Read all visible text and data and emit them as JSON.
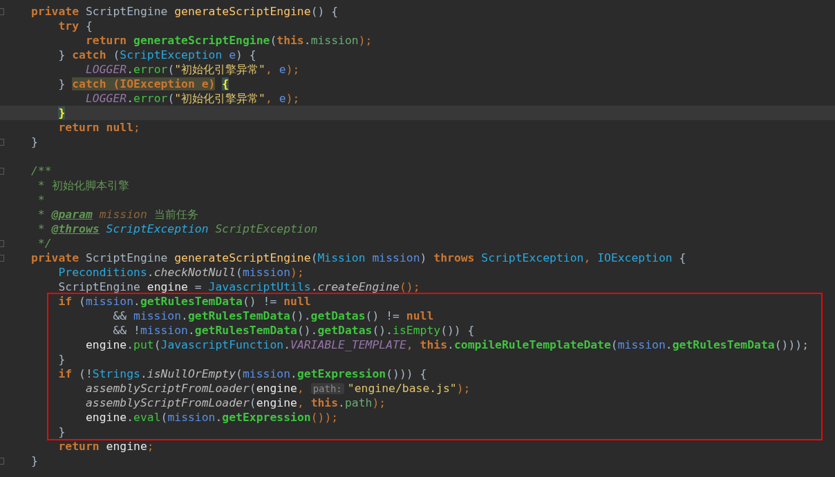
{
  "editor": {
    "lines": [
      {
        "kind": "code",
        "fold": true,
        "current": false,
        "tokens": [
          {
            "text": "private ",
            "kind": "kw"
          },
          {
            "text": "ScriptEngine ",
            "kind": "id"
          },
          {
            "text": "generateScriptEngine",
            "kind": "decl"
          },
          {
            "text": "() {",
            "kind": "id"
          }
        ],
        "children": [
          {
            "kind": "code",
            "fold": false,
            "current": false,
            "tokens": [
              {
                "text": "try ",
                "kind": "kw"
              },
              {
                "text": "{",
                "kind": "id"
              }
            ],
            "children": [
              {
                "kind": "code",
                "fold": false,
                "current": false,
                "tokens": [
                  {
                    "text": "return ",
                    "kind": "kw"
                  },
                  {
                    "text": "generateScriptEngine",
                    "kind": "call"
                  },
                  {
                    "text": "(",
                    "kind": "id"
                  },
                  {
                    "text": "this",
                    "kind": "kw"
                  },
                  {
                    "text": ".",
                    "kind": "id"
                  },
                  {
                    "text": "mission",
                    "kind": "field"
                  },
                  {
                    "text": ");",
                    "kind": "punct"
                  }
                ]
              }
            ]
          },
          {
            "kind": "code",
            "fold": false,
            "current": false,
            "tokens": [
              {
                "text": "} ",
                "kind": "id"
              },
              {
                "text": "catch ",
                "kind": "kw"
              },
              {
                "text": "(",
                "kind": "id"
              },
              {
                "text": "ScriptException ",
                "kind": "cls"
              },
              {
                "text": "e",
                "kind": "param"
              },
              {
                "text": ") {",
                "kind": "id"
              }
            ],
            "children": [
              {
                "kind": "code",
                "fold": false,
                "current": false,
                "tokens": [
                  {
                    "text": "LOGGER",
                    "kind": "const"
                  },
                  {
                    "text": ".",
                    "kind": "id"
                  },
                  {
                    "text": "error",
                    "kind": "call2"
                  },
                  {
                    "text": "(",
                    "kind": "id"
                  },
                  {
                    "text": "\"初始化引擎异常\"",
                    "kind": "str"
                  },
                  {
                    "text": ", ",
                    "kind": "punct"
                  },
                  {
                    "text": "e",
                    "kind": "param"
                  },
                  {
                    "text": ");",
                    "kind": "punct"
                  }
                ]
              }
            ]
          },
          {
            "kind": "code",
            "fold": false,
            "current": false,
            "tokens": [
              {
                "text": "} ",
                "kind": "id"
              },
              {
                "text": "catch (IOException e)",
                "kind": "hl"
              },
              {
                "text": "{",
                "kind": "brace"
              }
            ],
            "children": [
              {
                "kind": "code",
                "fold": false,
                "current": false,
                "tokens": [
                  {
                    "text": "LOGGER",
                    "kind": "const"
                  },
                  {
                    "text": ".",
                    "kind": "id"
                  },
                  {
                    "text": "error",
                    "kind": "call2"
                  },
                  {
                    "text": "(",
                    "kind": "id"
                  },
                  {
                    "text": "\"初始化引擎异常\"",
                    "kind": "str"
                  },
                  {
                    "text": ", ",
                    "kind": "punct"
                  },
                  {
                    "text": "e",
                    "kind": "param"
                  },
                  {
                    "text": ");",
                    "kind": "punct"
                  }
                ]
              }
            ]
          },
          {
            "kind": "code",
            "fold": false,
            "current": true,
            "tokens": [
              {
                "text": "}",
                "kind": "brace"
              }
            ]
          },
          {
            "kind": "code",
            "fold": false,
            "current": false,
            "tokens": [
              {
                "text": "return ",
                "kind": "kw"
              },
              {
                "text": "null",
                "kind": "kw"
              },
              {
                "text": ";",
                "kind": "punct"
              }
            ]
          }
        ]
      },
      {
        "kind": "code",
        "fold": true,
        "current": false,
        "tokens": [
          {
            "text": "}",
            "kind": "id"
          }
        ]
      },
      {
        "kind": "blank",
        "fold": false,
        "current": false
      },
      {
        "kind": "code",
        "fold": true,
        "current": false,
        "tokens": [
          {
            "text": "/**",
            "kind": "comment"
          }
        ]
      },
      {
        "kind": "doc",
        "fold": false,
        "current": false,
        "tokens": [
          {
            "text": "* ",
            "kind": "comment"
          },
          {
            "text": "初始化脚本引擎",
            "kind": "doctext"
          }
        ]
      },
      {
        "kind": "doc",
        "fold": false,
        "current": false,
        "tokens": [
          {
            "text": "*",
            "kind": "comment"
          }
        ]
      },
      {
        "kind": "doc",
        "fold": false,
        "current": false,
        "tokens": [
          {
            "text": "* ",
            "kind": "comment"
          },
          {
            "text": "@param",
            "kind": "doctag"
          },
          {
            "text": " mission ",
            "kind": "docparam"
          },
          {
            "text": "当前任务",
            "kind": "doctext"
          }
        ]
      },
      {
        "kind": "doc",
        "fold": false,
        "current": false,
        "tokens": [
          {
            "text": "* ",
            "kind": "comment"
          },
          {
            "text": "@throws",
            "kind": "doctag"
          },
          {
            "text": " ScriptException ",
            "kind": "doccls"
          },
          {
            "text": "ScriptException",
            "kind": "comment"
          }
        ]
      },
      {
        "kind": "doc",
        "fold": true,
        "current": false,
        "tokens": [
          {
            "text": "*/",
            "kind": "comment"
          }
        ]
      },
      {
        "kind": "code",
        "fold": true,
        "current": false,
        "tokens": [
          {
            "text": "private ",
            "kind": "kw"
          },
          {
            "text": "ScriptEngine ",
            "kind": "id"
          },
          {
            "text": "generateScriptEngine",
            "kind": "decl"
          },
          {
            "text": "(",
            "kind": "id"
          },
          {
            "text": "Mission ",
            "kind": "cls"
          },
          {
            "text": "mission",
            "kind": "param"
          },
          {
            "text": ") ",
            "kind": "id"
          },
          {
            "text": "throws ",
            "kind": "kw"
          },
          {
            "text": "ScriptException",
            "kind": "cls"
          },
          {
            "text": ", ",
            "kind": "punct"
          },
          {
            "text": "IOException ",
            "kind": "cls"
          },
          {
            "text": "{",
            "kind": "id"
          }
        ],
        "children": [
          {
            "kind": "code",
            "fold": false,
            "current": false,
            "tokens": [
              {
                "text": "Preconditions",
                "kind": "cls"
              },
              {
                "text": ".",
                "kind": "id"
              },
              {
                "text": "checkNotNull",
                "kind": "static"
              },
              {
                "text": "(",
                "kind": "id"
              },
              {
                "text": "mission",
                "kind": "param"
              },
              {
                "text": ");",
                "kind": "punct"
              }
            ]
          },
          {
            "kind": "code",
            "fold": false,
            "current": false,
            "tokens": [
              {
                "text": "ScriptEngine ",
                "kind": "id"
              },
              {
                "text": "engine ",
                "kind": "local"
              },
              {
                "text": "= ",
                "kind": "id"
              },
              {
                "text": "JavascriptUtils",
                "kind": "cls"
              },
              {
                "text": ".",
                "kind": "id"
              },
              {
                "text": "createEngine",
                "kind": "static"
              },
              {
                "text": "();",
                "kind": "punct"
              }
            ]
          },
          {
            "kind": "box",
            "children": [
              {
                "kind": "code",
                "fold": false,
                "current": false,
                "tokens": [
                  {
                    "text": "if ",
                    "kind": "kw"
                  },
                  {
                    "text": "(",
                    "kind": "id"
                  },
                  {
                    "text": "mission",
                    "kind": "param"
                  },
                  {
                    "text": ".",
                    "kind": "id"
                  },
                  {
                    "text": "getRulesTemData",
                    "kind": "call"
                  },
                  {
                    "text": "() != ",
                    "kind": "id"
                  },
                  {
                    "text": "null",
                    "kind": "kw"
                  }
                ],
                "children": [
                  {
                    "kind": "continuation",
                    "fold": false,
                    "current": false,
                    "tokens": [
                      {
                        "text": "&& ",
                        "kind": "id"
                      },
                      {
                        "text": "mission",
                        "kind": "param"
                      },
                      {
                        "text": ".",
                        "kind": "id"
                      },
                      {
                        "text": "getRulesTemData",
                        "kind": "call"
                      },
                      {
                        "text": "().",
                        "kind": "id"
                      },
                      {
                        "text": "getDatas",
                        "kind": "call"
                      },
                      {
                        "text": "() != ",
                        "kind": "id"
                      },
                      {
                        "text": "null",
                        "kind": "kw"
                      }
                    ]
                  },
                  {
                    "kind": "continuation",
                    "fold": false,
                    "current": false,
                    "tokens": [
                      {
                        "text": "&& !",
                        "kind": "id"
                      },
                      {
                        "text": "mission",
                        "kind": "param"
                      },
                      {
                        "text": ".",
                        "kind": "id"
                      },
                      {
                        "text": "getRulesTemData",
                        "kind": "call"
                      },
                      {
                        "text": "().",
                        "kind": "id"
                      },
                      {
                        "text": "getDatas",
                        "kind": "call"
                      },
                      {
                        "text": "().",
                        "kind": "id"
                      },
                      {
                        "text": "isEmpty",
                        "kind": "call2"
                      },
                      {
                        "text": "()) {",
                        "kind": "id"
                      }
                    ]
                  },
                  {
                    "kind": "code",
                    "fold": false,
                    "current": false,
                    "tokens": [
                      {
                        "text": "engine",
                        "kind": "local"
                      },
                      {
                        "text": ".",
                        "kind": "id"
                      },
                      {
                        "text": "put",
                        "kind": "call2"
                      },
                      {
                        "text": "(",
                        "kind": "id"
                      },
                      {
                        "text": "JavascriptFunction",
                        "kind": "cls"
                      },
                      {
                        "text": ".",
                        "kind": "id"
                      },
                      {
                        "text": "VARIABLE_TEMPLATE",
                        "kind": "const"
                      },
                      {
                        "text": ", ",
                        "kind": "punct"
                      },
                      {
                        "text": "this",
                        "kind": "kw"
                      },
                      {
                        "text": ".",
                        "kind": "id"
                      },
                      {
                        "text": "compileRuleTemplateDate",
                        "kind": "call"
                      },
                      {
                        "text": "(",
                        "kind": "id"
                      },
                      {
                        "text": "mission",
                        "kind": "param"
                      },
                      {
                        "text": ".",
                        "kind": "id"
                      },
                      {
                        "text": "getRulesTemData",
                        "kind": "call"
                      },
                      {
                        "text": "()));",
                        "kind": "id"
                      }
                    ]
                  }
                ]
              },
              {
                "kind": "code",
                "fold": false,
                "current": false,
                "tokens": [
                  {
                    "text": "}",
                    "kind": "id"
                  }
                ]
              },
              {
                "kind": "code",
                "fold": false,
                "current": false,
                "tokens": [
                  {
                    "text": "if ",
                    "kind": "kw"
                  },
                  {
                    "text": "(!",
                    "kind": "id"
                  },
                  {
                    "text": "Strings",
                    "kind": "cls"
                  },
                  {
                    "text": ".",
                    "kind": "id"
                  },
                  {
                    "text": "isNullOrEmpty",
                    "kind": "static"
                  },
                  {
                    "text": "(",
                    "kind": "id"
                  },
                  {
                    "text": "mission",
                    "kind": "param"
                  },
                  {
                    "text": ".",
                    "kind": "id"
                  },
                  {
                    "text": "getExpression",
                    "kind": "call"
                  },
                  {
                    "text": "())) {",
                    "kind": "id"
                  }
                ],
                "children": [
                  {
                    "kind": "code",
                    "fold": false,
                    "current": false,
                    "tokens": [
                      {
                        "text": "assemblyScriptFromLoader",
                        "kind": "static"
                      },
                      {
                        "text": "(",
                        "kind": "id"
                      },
                      {
                        "text": "engine",
                        "kind": "local"
                      },
                      {
                        "text": ", ",
                        "kind": "punct"
                      },
                      {
                        "text": "path:",
                        "kind": "hint"
                      },
                      {
                        "text": "\"engine/base.js\"",
                        "kind": "str"
                      },
                      {
                        "text": ");",
                        "kind": "punct"
                      }
                    ]
                  },
                  {
                    "kind": "code",
                    "fold": false,
                    "current": false,
                    "tokens": [
                      {
                        "text": "assemblyScriptFromLoader",
                        "kind": "static"
                      },
                      {
                        "text": "(",
                        "kind": "id"
                      },
                      {
                        "text": "engine",
                        "kind": "local"
                      },
                      {
                        "text": ", ",
                        "kind": "punct"
                      },
                      {
                        "text": "this",
                        "kind": "kw"
                      },
                      {
                        "text": ".",
                        "kind": "id"
                      },
                      {
                        "text": "path",
                        "kind": "field"
                      },
                      {
                        "text": ");",
                        "kind": "punct"
                      }
                    ]
                  },
                  {
                    "kind": "code",
                    "fold": false,
                    "current": false,
                    "tokens": [
                      {
                        "text": "engine",
                        "kind": "local"
                      },
                      {
                        "text": ".",
                        "kind": "id"
                      },
                      {
                        "text": "eval",
                        "kind": "call2"
                      },
                      {
                        "text": "(",
                        "kind": "id"
                      },
                      {
                        "text": "mission",
                        "kind": "param"
                      },
                      {
                        "text": ".",
                        "kind": "id"
                      },
                      {
                        "text": "getExpression",
                        "kind": "call"
                      },
                      {
                        "text": "());",
                        "kind": "punct"
                      }
                    ]
                  }
                ]
              },
              {
                "kind": "code",
                "fold": false,
                "current": false,
                "tokens": [
                  {
                    "text": "}",
                    "kind": "id"
                  }
                ]
              }
            ]
          },
          {
            "kind": "code",
            "fold": false,
            "current": false,
            "tokens": [
              {
                "text": "return ",
                "kind": "kw"
              },
              {
                "text": "engine",
                "kind": "local"
              },
              {
                "text": ";",
                "kind": "punct"
              }
            ]
          }
        ]
      },
      {
        "kind": "code",
        "fold": true,
        "current": false,
        "tokens": [
          {
            "text": "}",
            "kind": "id"
          }
        ]
      }
    ]
  }
}
